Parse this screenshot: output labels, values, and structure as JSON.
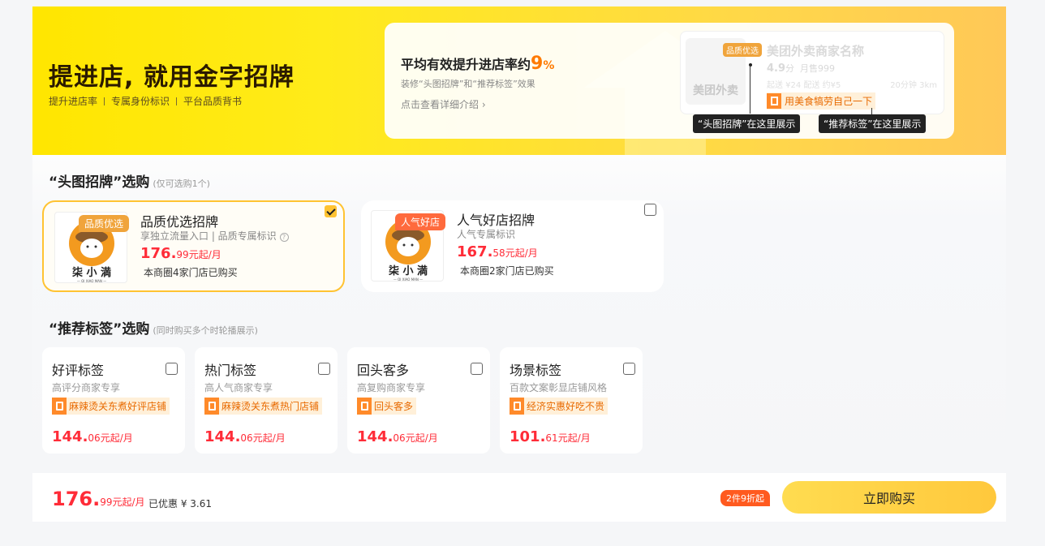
{
  "banner": {
    "title": "提进店, 就用金字招牌",
    "subs": [
      "提升进店率",
      "专属身份标识",
      "平台品质背书"
    ],
    "info_title": "平均有效提升进店率约",
    "info_pct": "9",
    "info_pct_unit": "%",
    "info_desc": "装修“头图招牌”和“推荐标签”效果",
    "info_link": "点击查看详细介绍 ›",
    "preview": {
      "logo_text": "美团外卖",
      "badge": "品质优选",
      "shop_name": "美团外卖商家名称",
      "rating": "4.9",
      "rating_unit": "分",
      "monthly_sales": "月售999",
      "shipping": "起送 ¥24   配送 约¥5",
      "time_distance": "20分钟 3km",
      "tag_text": "用美食犒劳自己一下"
    },
    "tip_head": "“头图招牌”在这里展示",
    "tip_tag": "“推荐标签”在这里展示"
  },
  "head_section": {
    "title": "“头图招牌”选购",
    "hint": "(仅可选购1个)",
    "cards": [
      {
        "badge": "品质优选",
        "badge_color": "#f0a43b",
        "title": "品质优选招牌",
        "desc": "享独立流量入口 | 品质专属标识",
        "price_int": "176.",
        "price_dec": "99",
        "unit": "元起/月",
        "sold": "本商圈4家门店已购买",
        "checked": true
      },
      {
        "badge": "人气好店",
        "badge_color": "#ff6a3d",
        "title": "人气好店招牌",
        "desc": "人气专属标识",
        "price_int": "167.",
        "price_dec": "58",
        "unit": "元起/月",
        "sold": "本商圈2家门店已购买",
        "checked": false
      }
    ],
    "logo_name": "柒 小 満",
    "logo_sub": "— QI XIAO MAN —"
  },
  "tag_section": {
    "title": "“推荐标签”选购",
    "hint": "(同时购买多个时轮播展示)",
    "cards": [
      {
        "title": "好评标签",
        "desc": "高评分商家专享",
        "tag": "麻辣烫关东煮好评店铺",
        "price_int": "144.",
        "price_dec": "06",
        "unit": "元起/月"
      },
      {
        "title": "热门标签",
        "desc": "高人气商家专享",
        "tag": "麻辣烫关东煮热门店铺",
        "price_int": "144.",
        "price_dec": "06",
        "unit": "元起/月"
      },
      {
        "title": "回头客多",
        "desc": "高复购商家专享",
        "tag": "回头客多",
        "price_int": "144.",
        "price_dec": "06",
        "unit": "元起/月"
      },
      {
        "title": "场景标签",
        "desc": "百款文案彰显店铺风格",
        "tag": "经济实惠好吃不贵",
        "price_int": "101.",
        "price_dec": "61",
        "unit": "元起/月"
      }
    ]
  },
  "footer": {
    "price_int": "176.",
    "price_dec": "99",
    "unit": "元起/月",
    "discount": "已优惠 ¥ 3.61",
    "promo": "2件9折起",
    "buy_label": "立即购买"
  },
  "colors": {
    "accent": "#ffc332",
    "price": "#ff2c38",
    "tag_bg": "#fff0d9",
    "tag_text": "#e86a00"
  }
}
